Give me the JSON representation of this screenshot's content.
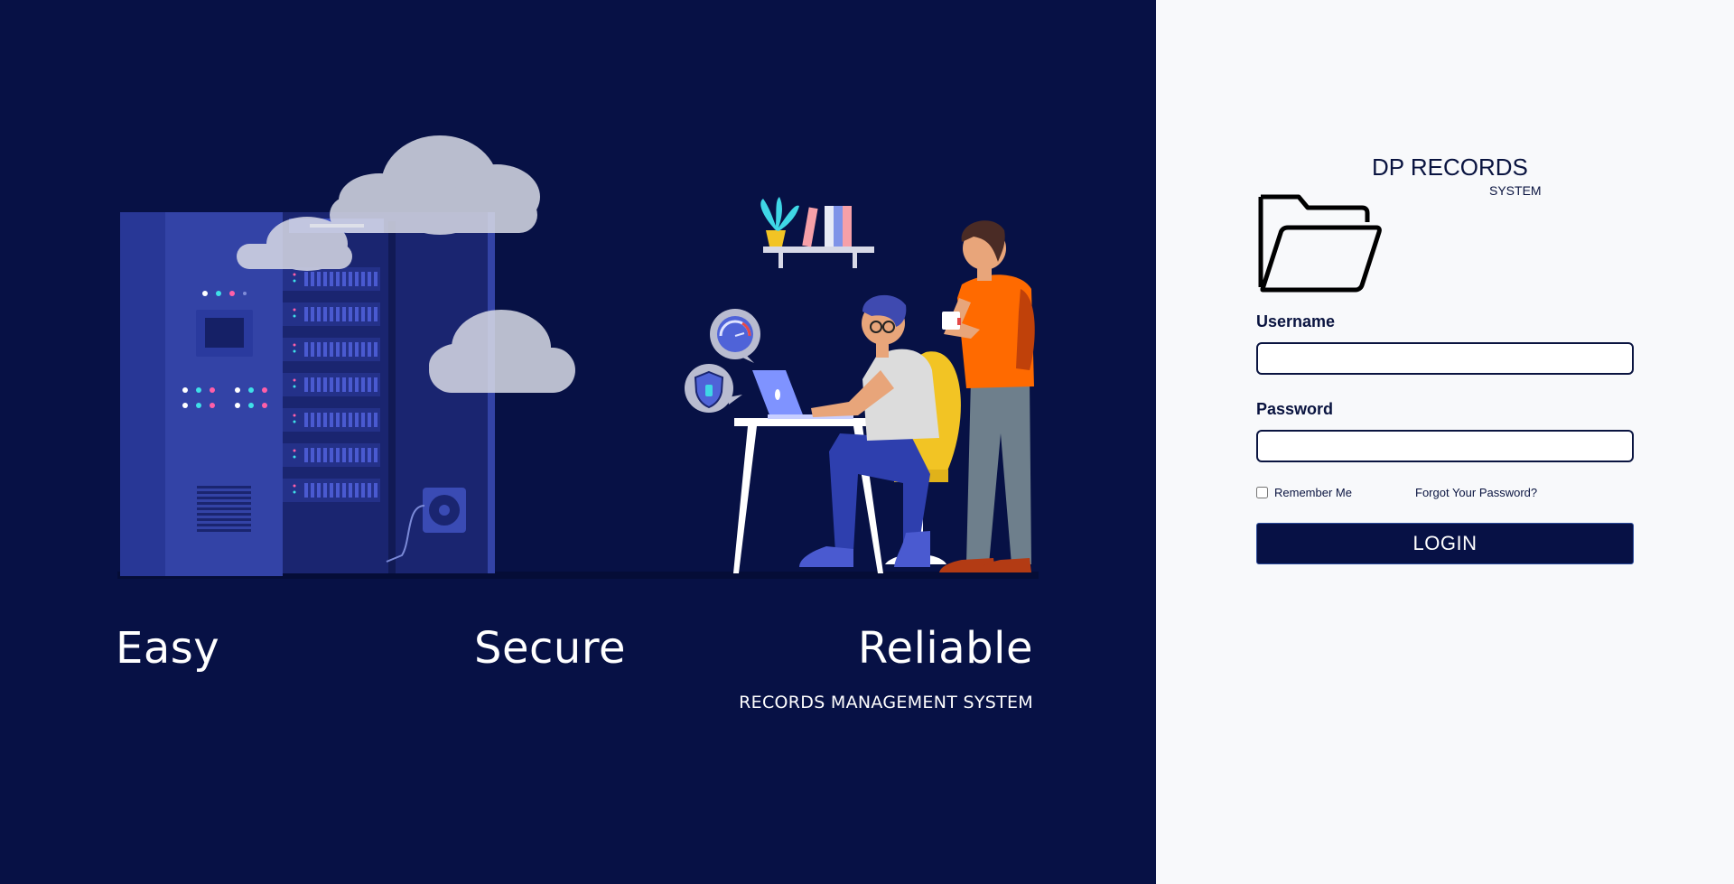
{
  "hero": {
    "taglines": [
      "Easy",
      "Secure",
      "Reliable"
    ],
    "subtitle": "RECORDS MANAGEMENT SYSTEM",
    "illustration": "server-rack-and-office-workers-illustration"
  },
  "brand": {
    "title": "DP RECORDS",
    "subtitle": "SYSTEM",
    "icon": "folder-open-icon"
  },
  "form": {
    "username_label": "Username",
    "username_value": "",
    "password_label": "Password",
    "password_value": "",
    "remember_label": "Remember Me",
    "remember_checked": false,
    "forgot_label": "Forgot Your Password?",
    "login_label": "LOGIN"
  },
  "colors": {
    "navy": "#071145",
    "panel": "#f8f9fb",
    "accent_orange": "#ff6a00"
  }
}
